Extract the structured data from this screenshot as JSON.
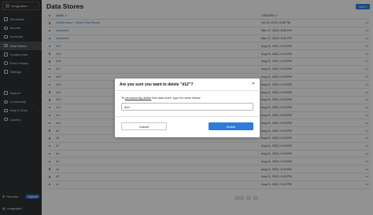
{
  "sidebar": {
    "workspace": "vungyuploh...",
    "items": [
      {
        "label": "Workflows",
        "icon": "workflow-icon"
      },
      {
        "label": "Secrets",
        "icon": "key-icon"
      },
      {
        "label": "Accounts",
        "icon": "user-icon"
      },
      {
        "label": "Data Stores",
        "icon": "database-icon",
        "active": true
      },
      {
        "label": "Components",
        "icon": "puzzle-icon"
      },
      {
        "label": "Event History",
        "icon": "history-icon"
      },
      {
        "label": "Settings",
        "icon": "gear-icon"
      }
    ],
    "bottom_items": [
      {
        "label": "Explore",
        "icon": "compass-icon"
      },
      {
        "label": "Community",
        "icon": "chat-icon"
      },
      {
        "label": "Help & Docs",
        "icon": "help-icon",
        "arrow": "›"
      },
      {
        "label": "Careers",
        "icon": "briefcase-icon"
      }
    ],
    "plan": {
      "label": "Free plan",
      "badge": "Upgrade"
    },
    "user": "vungyuploh..."
  },
  "page": {
    "title": "Data Stores",
    "new_button": "New ▾",
    "col_name": "NAME ⇕",
    "col_date": "CREATED ⇕",
    "more": "•••"
  },
  "rows": [
    {
      "name": "Github Issue - Notion Test Report",
      "date": "Jul 15, 2023, 6:46 PM"
    },
    {
      "name": "compare1",
      "date": "Mar 27, 2023, 8:46 PM"
    },
    {
      "name": "compare1",
      "date": "Mar 27, 2023, 8:45 PM"
    },
    {
      "name": "d11",
      "date": "Aug 11, 2022, 9:43 PM"
    },
    {
      "name": "d19",
      "date": "Aug 11, 2022, 9:43 PM"
    },
    {
      "name": "d18",
      "date": "Aug 11, 2022, 9:43 PM"
    },
    {
      "name": "d17",
      "date": "Aug 11, 2022, 9:43 PM"
    },
    {
      "name": "d16",
      "date": "Aug 11, 2022, 9:43 PM"
    },
    {
      "name": "d15",
      "date": "Aug 11, 2022, 9:43 PM"
    },
    {
      "name": "d14",
      "date": "Aug 11, 2022, 9:43 PM"
    },
    {
      "name": "d13",
      "date": "Aug 11, 2022, 9:43 PM"
    },
    {
      "name": "d12",
      "date": "Aug 11, 2022, 9:43 PM"
    },
    {
      "name": "d11",
      "date": "Aug 11, 2022, 9:43 PM"
    },
    {
      "name": "d10",
      "date": "Aug 11, 2022, 9:43 PM"
    },
    {
      "name": "d9",
      "date": "Aug 11, 2022, 9:43 PM"
    },
    {
      "name": "d8",
      "date": "Aug 11, 2022, 9:43 PM"
    },
    {
      "name": "d7",
      "date": "Aug 11, 2022, 9:43 PM"
    },
    {
      "name": "d6",
      "date": "Aug 11, 2022, 9:43 PM"
    },
    {
      "name": "d5",
      "date": "Aug 11, 2022, 9:43 PM"
    },
    {
      "name": "d4",
      "date": "Aug 11, 2022, 9:43 PM"
    },
    {
      "name": "d3",
      "date": "Aug 11, 2022, 9:43 PM"
    },
    {
      "name": "d1",
      "date": "Aug 11, 2022, 9:42 PM"
    }
  ],
  "modal": {
    "title": "Are you sure you want to delete \"d12\"?",
    "close": "✕",
    "text_before": "To ",
    "text_link": "permanently delete",
    "text_after": " this data store, type its name below:",
    "input_value": "d12",
    "cancel": "Cancel",
    "delete": "Delete"
  },
  "colors": {
    "accent": "#2f7bd9",
    "sidebar": "#2e3032"
  }
}
